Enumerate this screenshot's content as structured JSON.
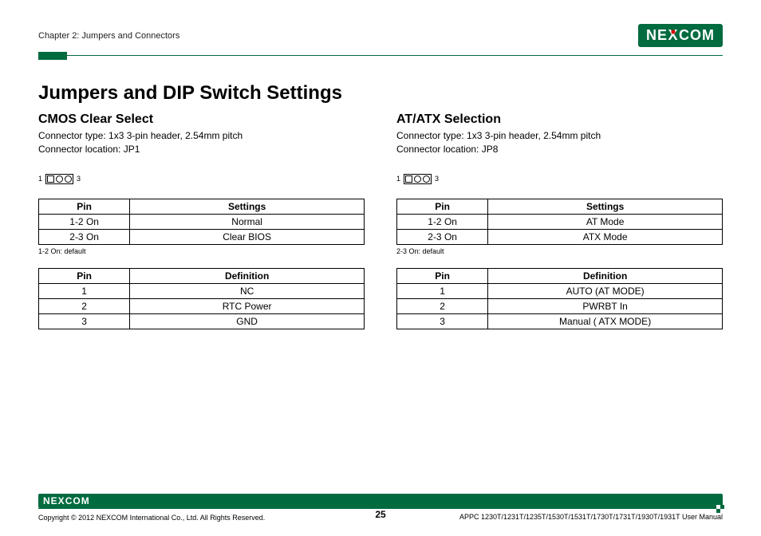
{
  "header": {
    "chapter": "Chapter 2: Jumpers and Connectors",
    "logo_pre": "NE",
    "logo_x": "X",
    "logo_post": "COM"
  },
  "title": "Jumpers and DIP Switch Settings",
  "left": {
    "heading": "CMOS Clear Select",
    "conn_type": "Connector type: 1x3 3-pin header, 2.54mm pitch",
    "conn_loc": "Connector location: JP1",
    "pin_left": "1",
    "pin_right": "3",
    "settings_headers": {
      "pin": "Pin",
      "settings": "Settings"
    },
    "settings_rows": [
      {
        "pin": "1-2 On",
        "settings": "Normal"
      },
      {
        "pin": "2-3 On",
        "settings": "Clear BIOS"
      }
    ],
    "settings_note": "1-2 On: default",
    "def_headers": {
      "pin": "Pin",
      "def": "Definition"
    },
    "def_rows": [
      {
        "pin": "1",
        "def": "NC"
      },
      {
        "pin": "2",
        "def": "RTC Power"
      },
      {
        "pin": "3",
        "def": "GND"
      }
    ]
  },
  "right": {
    "heading": "AT/ATX Selection",
    "conn_type": "Connector type: 1x3 3-pin header, 2.54mm pitch",
    "conn_loc": "Connector location: JP8",
    "pin_left": "1",
    "pin_right": "3",
    "settings_headers": {
      "pin": "Pin",
      "settings": "Settings"
    },
    "settings_rows": [
      {
        "pin": "1-2 On",
        "settings": "AT Mode"
      },
      {
        "pin": "2-3 On",
        "settings": "ATX Mode"
      }
    ],
    "settings_note": "2-3 On: default",
    "def_headers": {
      "pin": "Pin",
      "def": "Definition"
    },
    "def_rows": [
      {
        "pin": "1",
        "def": "AUTO (AT MODE)"
      },
      {
        "pin": "2",
        "def": "PWRBT In"
      },
      {
        "pin": "3",
        "def": "Manual ( ATX MODE)"
      }
    ]
  },
  "footer": {
    "logo_pre": "NE",
    "logo_x": "X",
    "logo_post": "COM",
    "copyright": "Copyright © 2012 NEXCOM International Co., Ltd. All Rights Reserved.",
    "page": "25",
    "manual": "APPC 1230T/1231T/1235T/1530T/1531T/1730T/1731T/1930T/1931T User Manual"
  }
}
